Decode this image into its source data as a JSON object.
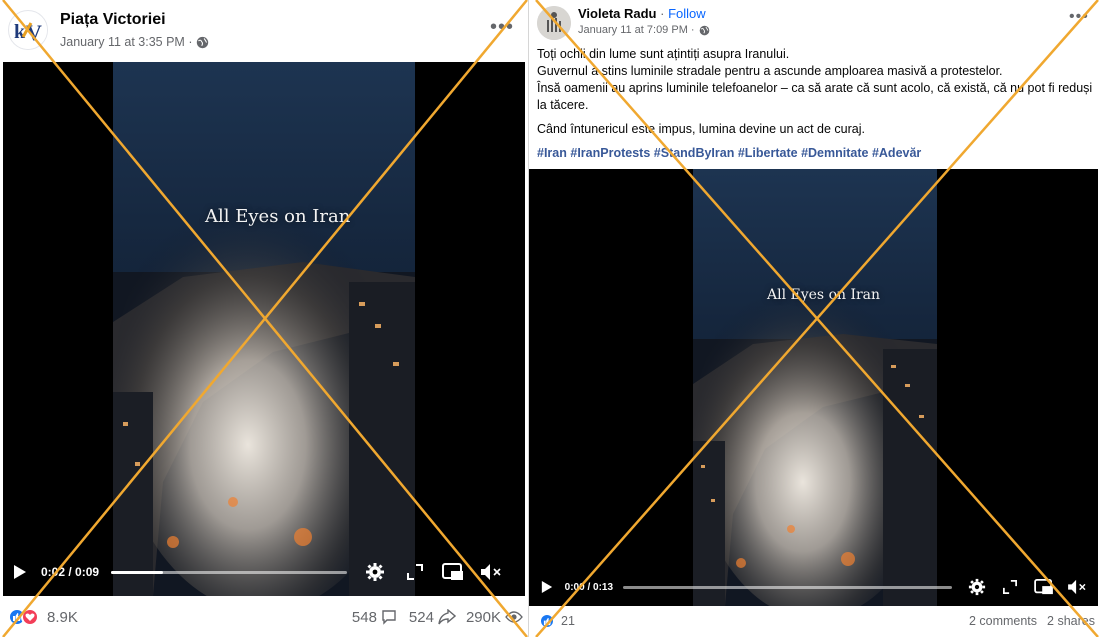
{
  "left_post": {
    "page_name": "Piața Victoriei",
    "timestamp": "January 11 at 3:35 PM ·",
    "video_overlay_text": "All Eyes on Iran",
    "video_time": "0:02 / 0:09",
    "video_progress": 0.22,
    "reaction_count": "8.9K",
    "comments": "548",
    "shares": "524",
    "views": "290K"
  },
  "right_post": {
    "author_name": "Violeta Radu",
    "separator": " · ",
    "follow_label": "Follow",
    "timestamp": "January 11 at 7:09 PM ·",
    "paragraphs": [
      "Toți ochii din lume sunt ațintiți asupra Iranului.",
      "Guvernul a stins luminile stradale pentru a ascunde amploarea masivă a protestelor.",
      "Însă oamenii au aprins luminile telefoanelor – ca să arate că sunt acolo, că există, că nu pot fi reduși la tăcere.",
      "Când întunericul este impus, lumina devine un act de curaj."
    ],
    "hashtags": [
      "#Iran",
      "#IranProtests",
      "#StandByIran",
      "#Libertate",
      "#Demnitate",
      "#Adevăr"
    ],
    "video_overlay_text": "All Eyes on Iran",
    "video_time": "0:00 / 0:13",
    "video_progress": 0.0,
    "reaction_count": "21",
    "comments": "2 comments",
    "shares": "2 shares"
  },
  "colors": {
    "cross": "#f0a830",
    "like_blue": "#1877f2",
    "love_red": "#f33e58",
    "link_blue": "#0866ff",
    "hashtag": "#385898",
    "meta_gray": "#65676b"
  },
  "icons": [
    "globe-icon",
    "more-icon",
    "play-icon",
    "settings-icon",
    "fullscreen-icon",
    "pip-icon",
    "mute-icon",
    "like-icon",
    "love-icon",
    "comment-icon",
    "share-icon",
    "views-icon"
  ]
}
